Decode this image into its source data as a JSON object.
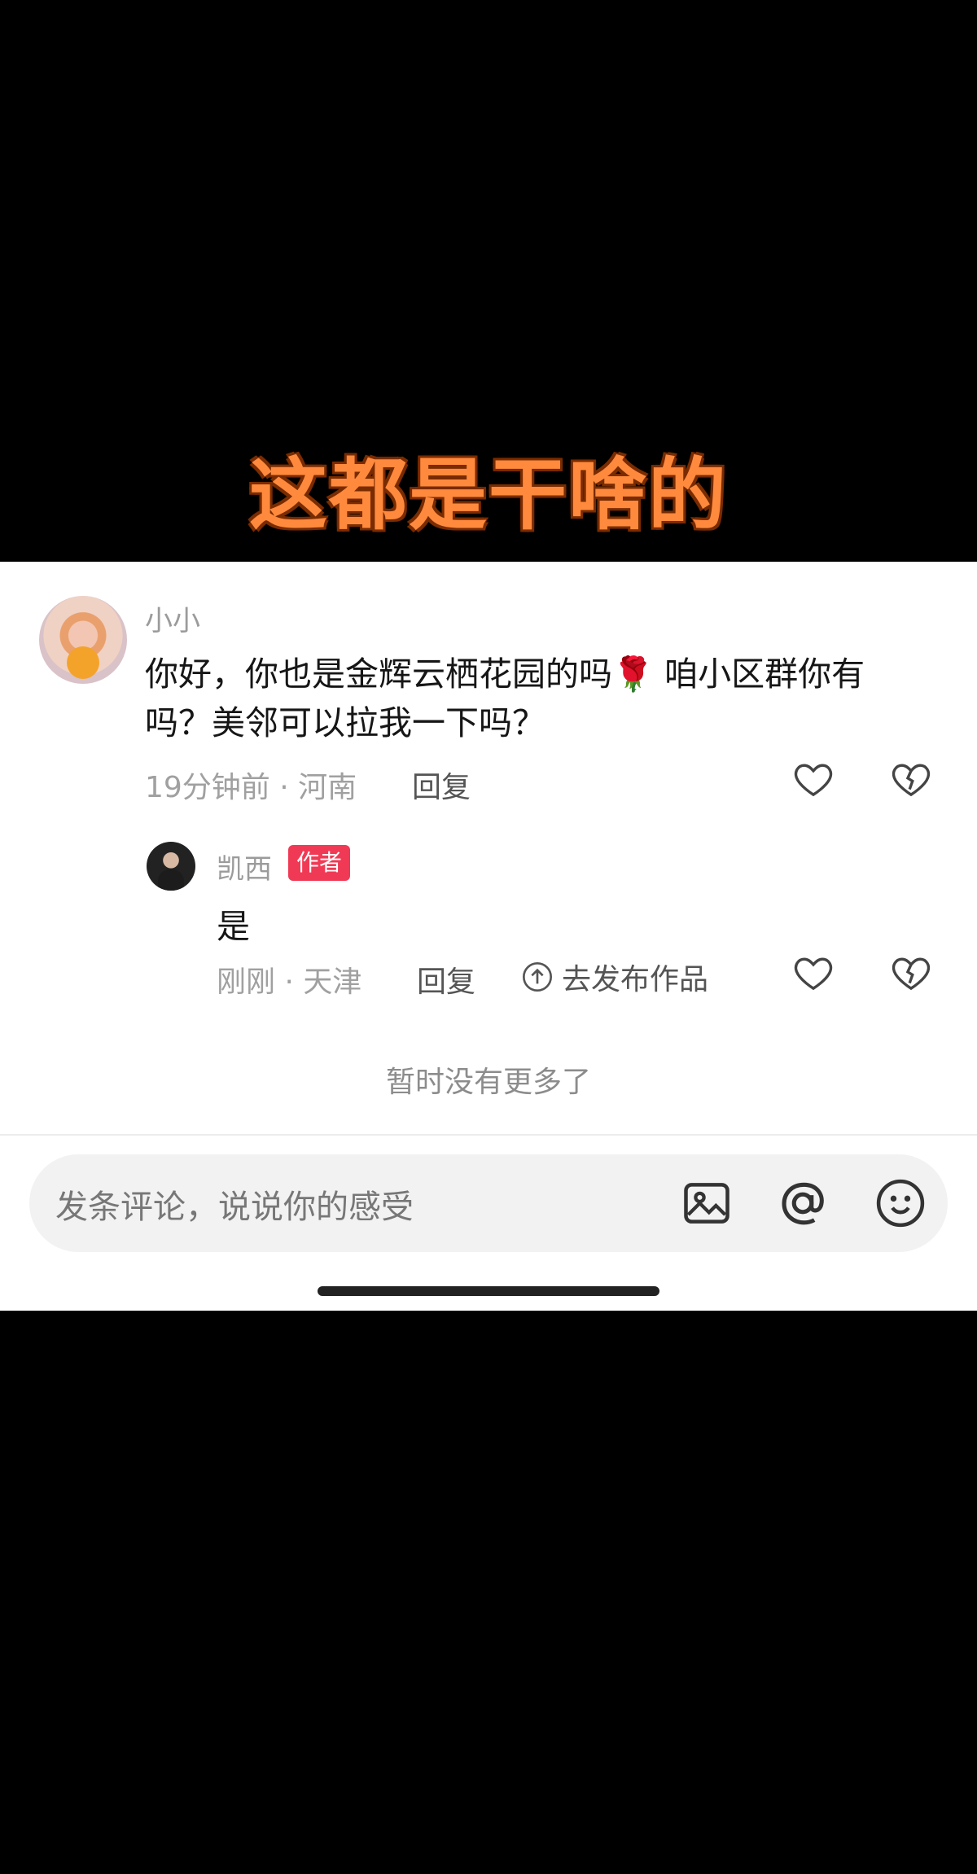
{
  "overlay": {
    "caption": "这都是干啥的"
  },
  "comment": {
    "username": "小小",
    "text_part1": "你好，你也是金辉云栖花园的吗",
    "emoji": "🌹",
    "text_part2": "咱小区群你有吗？美邻可以拉我一下吗？",
    "meta": "19分钟前 · 河南",
    "reply_label": "回复",
    "icons": {
      "like": "heart-outline-icon",
      "dislike": "broken-heart-icon"
    }
  },
  "reply": {
    "username": "凯西",
    "badge": "作者",
    "text": "是",
    "meta": "刚刚 · 天津",
    "reply_label": "回复",
    "publish_label": "去发布作品",
    "icons": {
      "publish": "upload-circle-icon",
      "like": "heart-outline-icon",
      "dislike": "broken-heart-icon"
    }
  },
  "list_end": "暂时没有更多了",
  "composer": {
    "placeholder": "发条评论，说说你的感受",
    "icons": [
      "image-icon",
      "at-icon",
      "emoji-icon"
    ]
  },
  "colors": {
    "badge": "#f03a55",
    "caption": "#ff8a3d",
    "background": "#000000"
  }
}
